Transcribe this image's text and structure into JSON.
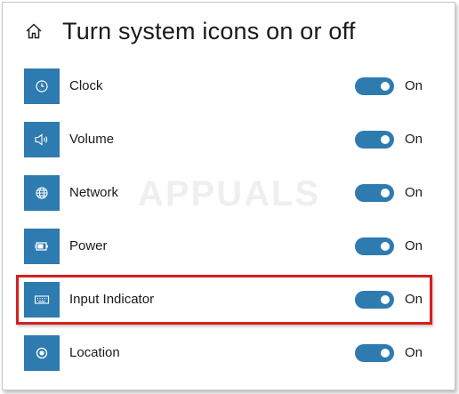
{
  "page": {
    "title": "Turn system icons on or off"
  },
  "accent_color": "#2e7bb0",
  "highlight_color": "#d52020",
  "icons": {
    "home": "home-icon"
  },
  "items": [
    {
      "label": "Clock",
      "icon": "clock-icon",
      "state": "On",
      "enabled": true
    },
    {
      "label": "Volume",
      "icon": "volume-icon",
      "state": "On",
      "enabled": true
    },
    {
      "label": "Network",
      "icon": "globe-icon",
      "state": "On",
      "enabled": true
    },
    {
      "label": "Power",
      "icon": "battery-plug-icon",
      "state": "On",
      "enabled": true
    },
    {
      "label": "Input Indicator",
      "icon": "keyboard-icon",
      "state": "On",
      "enabled": true,
      "highlighted": true
    },
    {
      "label": "Location",
      "icon": "location-icon",
      "state": "On",
      "enabled": true
    }
  ],
  "watermark": {
    "text": "APPUALS"
  }
}
